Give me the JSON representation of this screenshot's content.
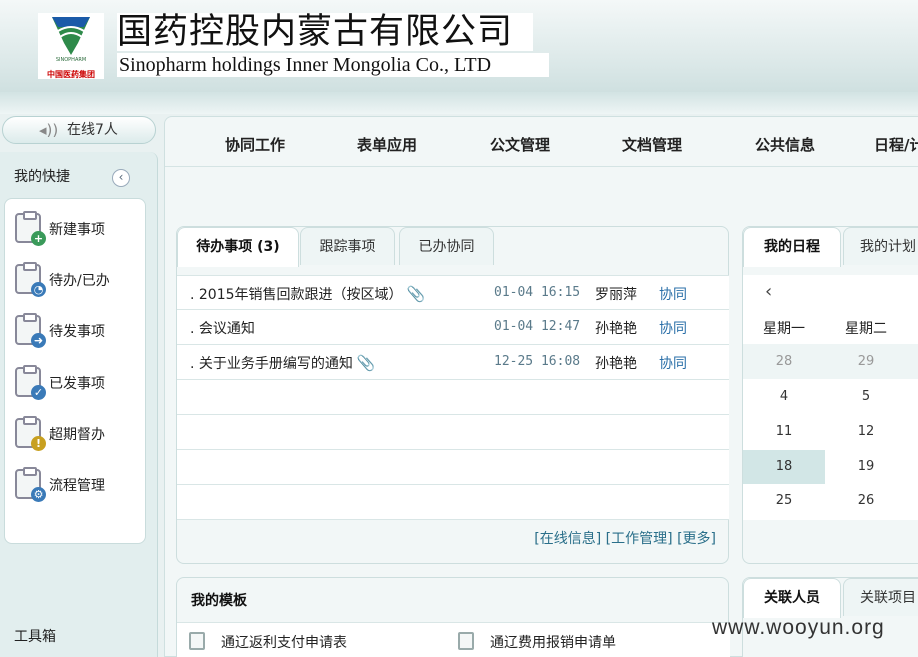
{
  "header": {
    "company_cn": "国药控股内蒙古有限公司",
    "company_en": "Sinopharm holdings Inner Mongolia Co., LTD",
    "logo_en": "SINOPHARM",
    "logo_cn": "中国医药集团"
  },
  "online": {
    "icon": "speaker-icon",
    "label": "在线7人"
  },
  "sidebar": {
    "title": "我的快捷",
    "collapse_icon": "chevron-left-icon",
    "collapse_glyph": "‹",
    "items": [
      {
        "label": "新建事项",
        "icon": "new-item-icon",
        "badge": "+",
        "color": "#3a9a5a"
      },
      {
        "label": "待办/已办",
        "icon": "clock-icon",
        "badge": "◔",
        "color": "#3a7ab8"
      },
      {
        "label": "待发事项",
        "icon": "send-pending-icon",
        "badge": "➜",
        "color": "#3a7ab8"
      },
      {
        "label": "已发事项",
        "icon": "sent-check-icon",
        "badge": "✓",
        "color": "#3a7ab8"
      },
      {
        "label": "超期督办",
        "icon": "warning-icon",
        "badge": "!",
        "color": "#c8a020"
      },
      {
        "label": "流程管理",
        "icon": "workflow-icon",
        "badge": "⚙",
        "color": "#3a7ab8"
      }
    ],
    "toolbox": "工具箱"
  },
  "nav": [
    "协同工作",
    "表单应用",
    "公文管理",
    "文档管理",
    "公共信息",
    "日程/计"
  ],
  "todo": {
    "tabs": [
      "待办事项 (3)",
      "跟踪事项",
      "已办协同"
    ],
    "rows": [
      {
        "subject": ". 2015年销售回款跟进（按区域）",
        "attachment": true,
        "time": "01-04 16:15",
        "sender": "罗丽萍",
        "type": "协同"
      },
      {
        "subject": ". 会议通知",
        "attachment": false,
        "time": "01-04 12:47",
        "sender": "孙艳艳",
        "type": "协同"
      },
      {
        "subject": ". 关于业务手册编写的通知",
        "attachment": true,
        "time": "12-25 16:08",
        "sender": "孙艳艳",
        "type": "协同"
      }
    ],
    "clip_glyph": "📎",
    "links": [
      "[在线信息]",
      "[工作管理]",
      "[更多]"
    ]
  },
  "schedule": {
    "tabs": [
      "我的日程",
      "我的计划"
    ],
    "prev_icon": "chevron-left-icon",
    "prev_glyph": "‹",
    "weekdays": [
      "星期一",
      "星期二"
    ],
    "weeks": [
      [
        "28",
        "29"
      ],
      [
        "4",
        "5"
      ],
      [
        "11",
        "12"
      ],
      [
        "18",
        "19"
      ],
      [
        "25",
        "26"
      ]
    ],
    "dim_cells": [
      "28",
      "29"
    ],
    "today": "18"
  },
  "templates": {
    "title": "我的模板",
    "items": [
      "通辽返利支付申请表",
      "通辽费用报销申请单"
    ]
  },
  "related": {
    "tabs": [
      "关联人员",
      "关联项目"
    ]
  },
  "watermark": "www.wooyun.org"
}
